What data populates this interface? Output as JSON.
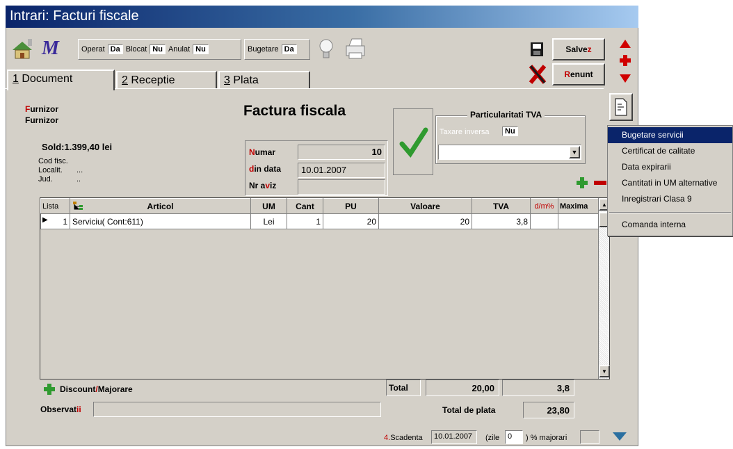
{
  "window": {
    "title": "Intrari: Facturi fiscale"
  },
  "toolbar": {
    "operat_label": "Operat",
    "operat_value": "Da",
    "blocat_label": "Blocat",
    "blocat_value": "Nu",
    "anulat_label": "Anulat",
    "anulat_value": "Nu",
    "bugetare_label": "Bugetare",
    "bugetare_value": "Da",
    "save_label_pre": "Salve",
    "save_label_hot": "z",
    "cancel_label_hot": "R",
    "cancel_label_post": "enunt"
  },
  "tabs": [
    {
      "num": "1",
      "label": "Document"
    },
    {
      "num": "2",
      "label": "Receptie"
    },
    {
      "num": "3",
      "label": "Plata"
    }
  ],
  "supplier": {
    "label_hot": "F",
    "label_rest": "urnizor",
    "name": "Furnizor",
    "sold": "Sold:1.399,40 lei",
    "cod_fisc_label": "Cod fisc.",
    "localit_label": "Localit.",
    "localit_value": "...",
    "jud_label": "Jud.",
    "jud_value": ".."
  },
  "invoice": {
    "heading": "Factura fiscala",
    "numar_hot": "N",
    "numar_rest": "umar",
    "numar_value": "10",
    "data_hot": "d",
    "data_rest": "in data",
    "data_value": "10.01.2007",
    "aviz_pre": "Nr a",
    "aviz_hot": "v",
    "aviz_post": "iz",
    "aviz_value": ""
  },
  "tva": {
    "title": "Particularitati TVA",
    "taxare_label": "Taxare inversa",
    "taxare_value": "Nu",
    "dropdown_value": ""
  },
  "grid": {
    "headers": [
      "Lista",
      "Articol",
      "UM",
      "Cant",
      "PU",
      "Valoare",
      "TVA",
      "d/m%",
      "Maxima"
    ],
    "rows": [
      {
        "lista": "1",
        "articol": "Serviciu( Cont:611)",
        "um": "Lei",
        "cant": "1",
        "pu": "20",
        "valoare": "20",
        "tva": "3,8",
        "dm": "",
        "maxima": ""
      }
    ]
  },
  "footer": {
    "discount_label": "Discount",
    "discount_sep": "/",
    "majorare_label": "Majorare",
    "total_label": "Total",
    "total_value": "20,00",
    "total_tva": "3,8",
    "observatii_pre": "Observat",
    "observatii_hot": "ii",
    "observatii_value": "",
    "total_plata_label": "Total de plata",
    "total_plata_value": "23,80",
    "scadenta_num": "4.",
    "scadenta_label": "Scadenta",
    "scadenta_value": "10.01.2007",
    "zile_label": "(zile",
    "zile_value": "0",
    "majorari_label": ") % majorari",
    "majorari_value": ""
  },
  "context_menu": {
    "items": [
      "Bugetare servicii",
      "Certificat de calitate",
      "Data expirarii",
      "Cantitati in UM alternative",
      "Inregistrari Clasa 9"
    ],
    "items_after_sep": [
      "Comanda interna"
    ]
  },
  "colors": {
    "titlebar": "#0a246a",
    "accent_red": "#c00000",
    "selection": "#0a246a",
    "face": "#d4d0c8"
  }
}
